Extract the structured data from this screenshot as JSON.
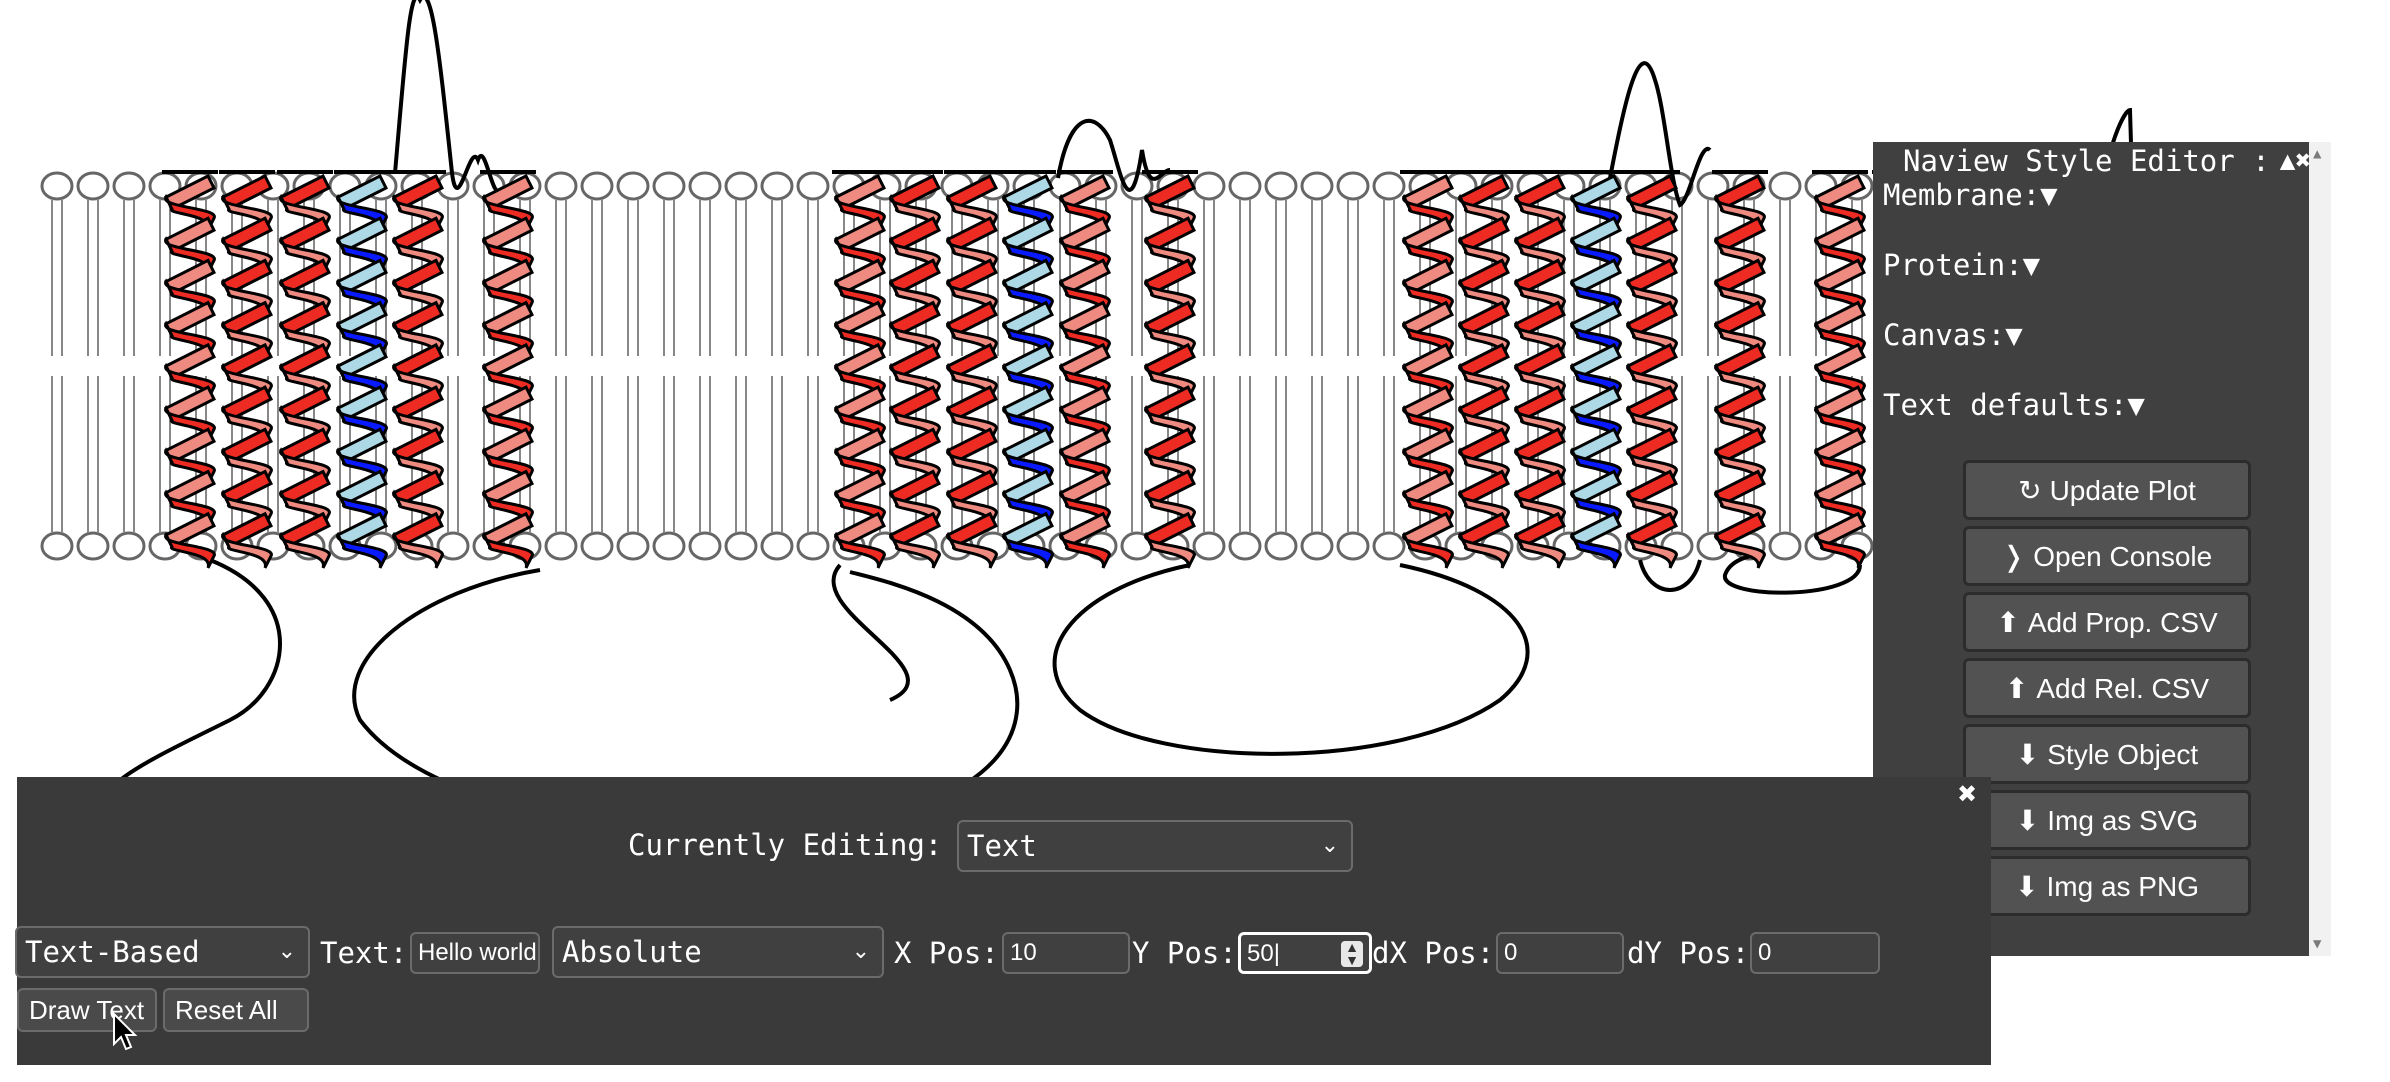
{
  "canvas": {
    "helix_colors": {
      "red": "#ee2b22",
      "salmon": "#ef8a80",
      "blue": "#0a1aff",
      "lightblue": "#add8e6"
    }
  },
  "style_editor": {
    "title": "Naview Style Editor :",
    "controls": {
      "collapse": "▲",
      "close": "✖"
    },
    "sections": [
      {
        "label": "Membrane:▼"
      },
      {
        "label": "Protein:▼"
      },
      {
        "label": "Canvas:▼"
      },
      {
        "label": "Text defaults:▼"
      }
    ],
    "buttons": [
      {
        "icon": "↻",
        "label": "Update Plot"
      },
      {
        "icon": "❭",
        "label": "Open Console"
      },
      {
        "icon": "⬆",
        "label": "Add Prop. CSV"
      },
      {
        "icon": "⬆",
        "label": "Add Rel. CSV"
      },
      {
        "icon": "⬇",
        "label": "Style Object"
      },
      {
        "icon": "⬇",
        "label": "Img as SVG"
      },
      {
        "icon": "⬇",
        "label": "Img as PNG"
      }
    ]
  },
  "edit_panel": {
    "close": "✖",
    "currently_editing_label": "Currently Editing:",
    "currently_editing_value": "Text",
    "mode_value": "Text-Based",
    "text_label": "Text:",
    "text_value": "Hello world",
    "position_mode_value": "Absolute",
    "x_label": "X Pos:",
    "x_value": "10",
    "y_label": "Y Pos:",
    "y_value": "50",
    "dx_label": "dX Pos:",
    "dx_value": "0",
    "dy_label": "dY Pos:",
    "dy_value": "0",
    "draw_button": "Draw Text",
    "reset_button": "Reset All"
  }
}
